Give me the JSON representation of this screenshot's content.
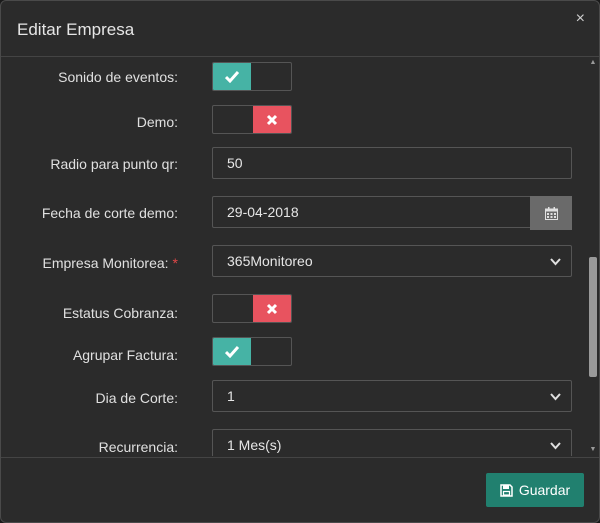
{
  "modal": {
    "title": "Editar Empresa"
  },
  "form": {
    "sonido_eventos": {
      "label": "Sonido de eventos:",
      "enabled": true
    },
    "demo": {
      "label": "Demo:",
      "enabled": false
    },
    "radio_qr": {
      "label": "Radio para punto qr:",
      "value": "50"
    },
    "fecha_corte": {
      "label": "Fecha de corte demo:",
      "value": "29-04-2018"
    },
    "empresa_monitorea": {
      "label": "Empresa Monitorea:",
      "required_mark": "*",
      "value": "365Monitoreo"
    },
    "estatus_cobranza": {
      "label": "Estatus Cobranza:",
      "enabled": false
    },
    "agrupar_factura": {
      "label": "Agrupar Factura:",
      "enabled": true
    },
    "dia_corte": {
      "label": "Dia de Corte:",
      "value": "1"
    },
    "recurrencia": {
      "label": "Recurrencia:",
      "value": "1 Mes(s)"
    }
  },
  "footer": {
    "save_label": "Guardar"
  },
  "colors": {
    "toggle_on": "#46b3a5",
    "toggle_off": "#e8535f",
    "save_button": "#21806f"
  }
}
